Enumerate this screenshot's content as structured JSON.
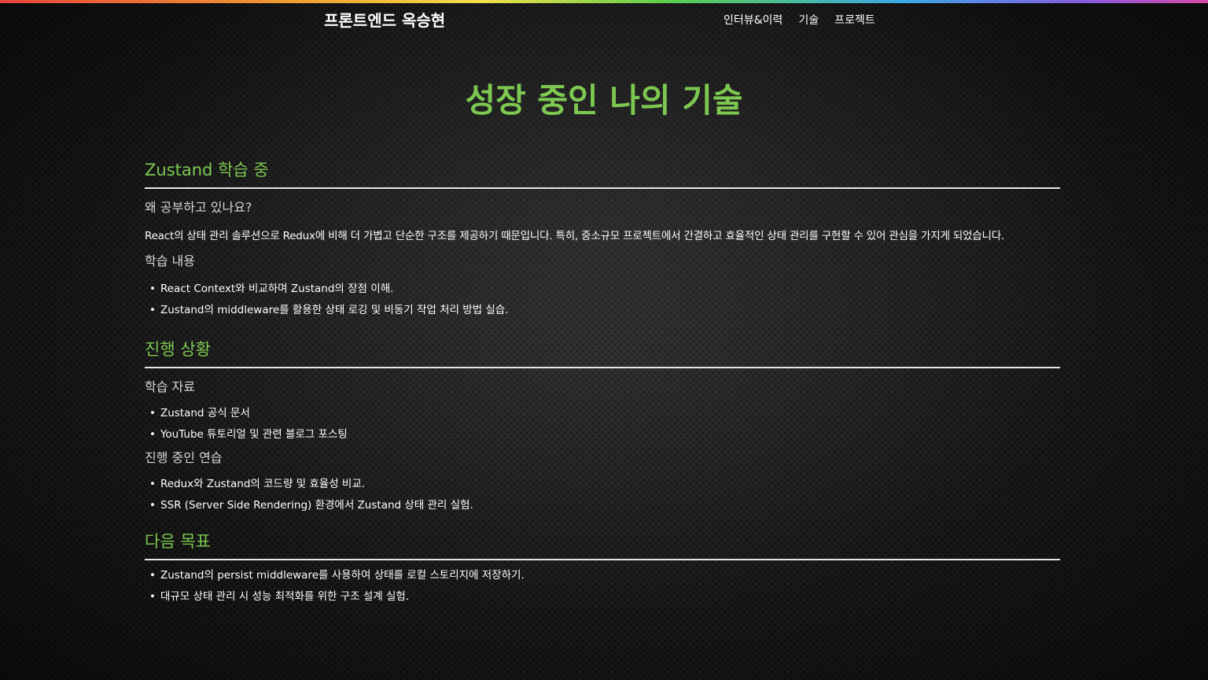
{
  "header": {
    "site_title": "프론트엔드 옥승현",
    "nav": [
      "인터뷰&이력",
      "기술",
      "프로젝트"
    ]
  },
  "page_title": "성장 중인 나의 기술",
  "sections": [
    {
      "heading": "Zustand 학습 중",
      "why_label": "왜 공부하고 있나요?",
      "why_text": "React의 상태 관리 솔루션으로 Redux에 비해 더 가볍고 단순한 구조를 제공하기 때문입니다. 특히, 중소규모 프로젝트에서 간결하고 효율적인 상태 관리를 구현할 수 있어 관심을 가지게 되었습니다.",
      "content_label": "학습 내용",
      "content_items": [
        "React Context와 비교하며 Zustand의 장점 이해.",
        "Zustand의 middleware를 활용한 상태 로깅 및 비동기 작업 처리 방법 실습."
      ]
    },
    {
      "heading": "진행 상황",
      "materials_label": "학습 자료",
      "materials_items": [
        "Zustand 공식 문서",
        "YouTube 튜토리얼 및 관련 블로그 포스팅"
      ],
      "practice_label": "진행 중인 연습",
      "practice_items": [
        "Redux와 Zustand의 코드량 및 효율성 비교.",
        "SSR (Server Side Rendering) 환경에서 Zustand 상태 관리 실험."
      ]
    },
    {
      "heading": "다음 목표",
      "goal_items": [
        "Zustand의 persist middleware를 사용하여 상태를 로컬 스토리지에 저장하기.",
        "대규모 상태 관리 시 성능 최적화를 위한 구조 설계 실험."
      ]
    }
  ],
  "bullet_char": "•",
  "colors": {
    "accent": "#7cc850",
    "background": "#1a1a1a",
    "text": "#ffffff"
  }
}
